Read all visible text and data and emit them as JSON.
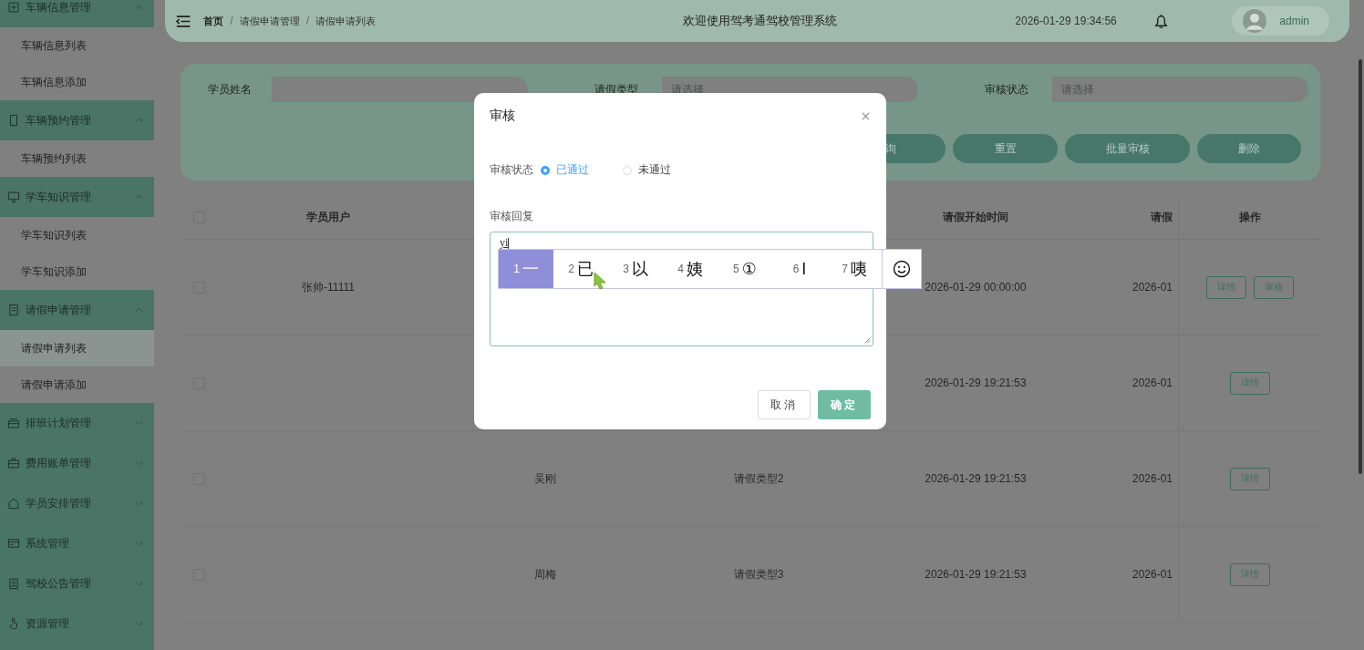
{
  "sidebar": {
    "menus": [
      {
        "label": "车辆信息管理",
        "expanded": true,
        "children": [
          {
            "label": "车辆信息列表",
            "selected": false
          },
          {
            "label": "车辆信息添加",
            "selected": false
          }
        ]
      },
      {
        "label": "车辆预约管理",
        "expanded": true,
        "children": [
          {
            "label": "车辆预约列表",
            "selected": false
          }
        ]
      },
      {
        "label": "学车知识管理",
        "expanded": true,
        "children": [
          {
            "label": "学车知识列表",
            "selected": false
          },
          {
            "label": "学车知识添加",
            "selected": false
          }
        ]
      },
      {
        "label": "请假申请管理",
        "expanded": true,
        "children": [
          {
            "label": "请假申请列表",
            "selected": true
          },
          {
            "label": "请假申请添加",
            "selected": false
          }
        ]
      },
      {
        "label": "排班计划管理",
        "expanded": false
      },
      {
        "label": "费用账单管理",
        "expanded": false
      },
      {
        "label": "学员安排管理",
        "expanded": false
      },
      {
        "label": "系统管理",
        "expanded": false
      },
      {
        "label": "驾校公告管理",
        "expanded": false
      },
      {
        "label": "资源管理",
        "expanded": false
      }
    ]
  },
  "header": {
    "breadcrumb": [
      "首页",
      "请假申请管理",
      "请假申请列表"
    ],
    "breadcrumb_separator": "/",
    "title": "欢迎使用驾考通驾校管理系统",
    "datetime": "2026-01-29 19:34:56",
    "user": "admin"
  },
  "search": {
    "fields": [
      {
        "label": "学员姓名",
        "kind": "text"
      },
      {
        "label": "请假类型",
        "kind": "select",
        "placeholder": "请选择"
      },
      {
        "label": "审核状态",
        "kind": "select",
        "placeholder": "请选择"
      }
    ],
    "buttons": [
      "询",
      "重置",
      "批量审核",
      "删除"
    ]
  },
  "table": {
    "select_all_checked": false,
    "columns": [
      "学员用户",
      "请假开始时间",
      "请假",
      "操作"
    ],
    "rows": [
      {
        "checked": false,
        "student_user": "张帅-11111",
        "start_time": "2026-01-29 00:00:00",
        "column_6": "2026-01",
        "actions": [
          "详情",
          "审核"
        ]
      },
      {
        "checked": false,
        "start_time": "2026-01-29 19:21:53",
        "column_6": "2026-01",
        "actions": [
          "详情"
        ]
      },
      {
        "checked": false,
        "column_3": "吴刚",
        "column_4": "请假类型2",
        "start_time": "2026-01-29 19:21:53",
        "column_6": "2026-01",
        "actions": [
          "详情"
        ]
      },
      {
        "checked": false,
        "column_3": "周梅",
        "column_4": "请假类型3",
        "start_time": "2026-01-29 19:21:53",
        "column_6": "2026-01",
        "actions": [
          "详情"
        ]
      }
    ]
  },
  "dialog": {
    "title": "审核",
    "status_label": "审核状态",
    "options": [
      {
        "label": "已通过",
        "selected": true
      },
      {
        "label": "未通过",
        "selected": false
      }
    ],
    "reply_label": "审核回复",
    "reply_value": "yi",
    "ime_candidates": [
      {
        "index": "1",
        "text": "一",
        "selected": true
      },
      {
        "index": "2",
        "text": "已",
        "selected": false
      },
      {
        "index": "3",
        "text": "以",
        "selected": false
      },
      {
        "index": "4",
        "text": "姨",
        "selected": false
      },
      {
        "index": "5",
        "text": "①",
        "selected": false
      },
      {
        "index": "6",
        "text": "I",
        "selected": false
      },
      {
        "index": "7",
        "text": "咦",
        "selected": false
      }
    ],
    "buttons": [
      "取消",
      "确定"
    ]
  }
}
